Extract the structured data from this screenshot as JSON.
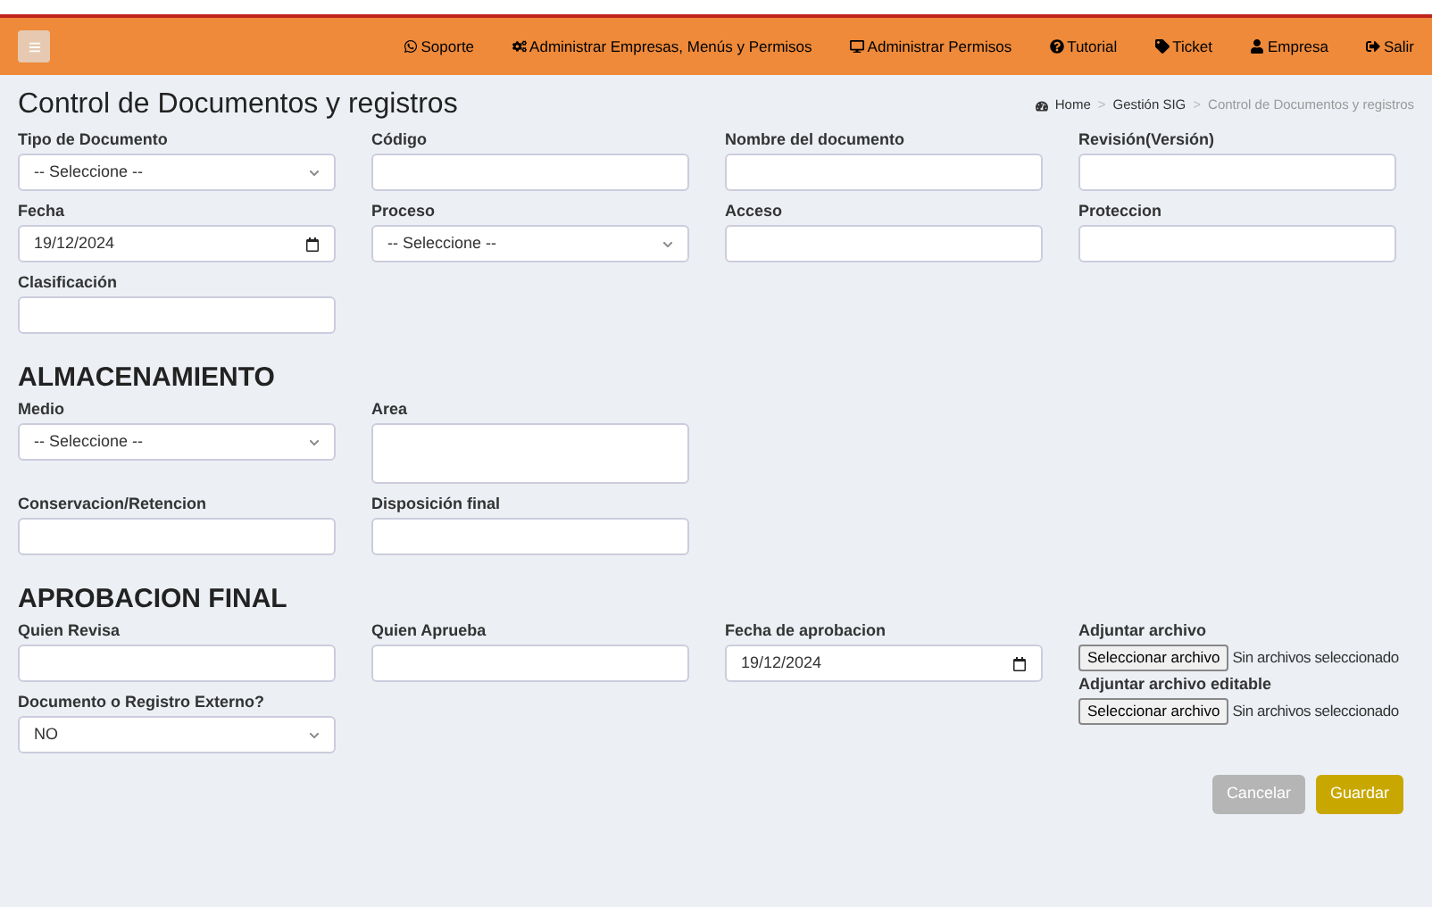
{
  "navbar": {
    "items": [
      {
        "kind": "whatsapp",
        "label": "Soporte"
      },
      {
        "kind": "gears",
        "label": "Administrar Empresas, Menús y Permisos"
      },
      {
        "kind": "monitor",
        "label": "Administrar Permisos"
      },
      {
        "kind": "question",
        "label": "Tutorial"
      },
      {
        "kind": "tag",
        "label": "Ticket"
      },
      {
        "kind": "user",
        "label": "Empresa"
      },
      {
        "kind": "signout",
        "label": "Salir"
      }
    ]
  },
  "page": {
    "title": "Control de Documentos y registros",
    "breadcrumb": [
      {
        "label": "Home",
        "selected": false
      },
      {
        "label": "Gestión SIG",
        "selected": false
      },
      {
        "label": "Control de Documentos y registros",
        "selected": true
      }
    ],
    "breadcrumb_separator": ">"
  },
  "sections": [
    {
      "fields": [
        {
          "kind": "select",
          "label": "Tipo de Documento",
          "value": "-- Seleccione --"
        },
        {
          "kind": "text",
          "label": "Código"
        },
        {
          "kind": "text",
          "label": "Nombre del documento"
        },
        {
          "kind": "text",
          "label": "Revisión(Versión)"
        },
        {
          "kind": "date",
          "label": "Fecha",
          "value": "19/12/2024"
        },
        {
          "kind": "select",
          "label": "Proceso",
          "value": "-- Seleccione --"
        },
        {
          "kind": "text",
          "label": "Acceso"
        },
        {
          "kind": "text",
          "label": "Proteccion"
        },
        {
          "kind": "text",
          "label": "Clasificación"
        }
      ]
    },
    {
      "heading": "ALMACENAMIENTO",
      "fields": [
        {
          "kind": "select",
          "label": "Medio",
          "value": "-- Seleccione --"
        },
        {
          "kind": "textarea",
          "label": "Area"
        },
        {
          "kind": "break"
        },
        {
          "kind": "text",
          "label": "Conservacion/Retencion"
        },
        {
          "kind": "text",
          "label": "Disposición final"
        }
      ]
    },
    {
      "heading": "APROBACION FINAL",
      "fields": [
        {
          "kind": "text",
          "label": "Quien Revisa"
        },
        {
          "kind": "text",
          "label": "Quien Aprueba"
        },
        {
          "kind": "date",
          "label": "Fecha de aprobacion",
          "value": "19/12/2024"
        },
        {
          "kind": "files",
          "items": [
            {
              "label": "Adjuntar archivo",
              "button": "Seleccionar archivo",
              "status": "Sin archivos seleccionado"
            },
            {
              "label": "Adjuntar archivo editable",
              "button": "Seleccionar archivo",
              "status": "Sin archivos seleccionado"
            }
          ]
        },
        {
          "kind": "select",
          "label": "Documento o Registro Externo?",
          "value": "NO"
        }
      ]
    }
  ],
  "buttons": [
    {
      "kind": "cancel",
      "label": "Cancelar"
    },
    {
      "kind": "save",
      "label": "Guardar"
    }
  ]
}
